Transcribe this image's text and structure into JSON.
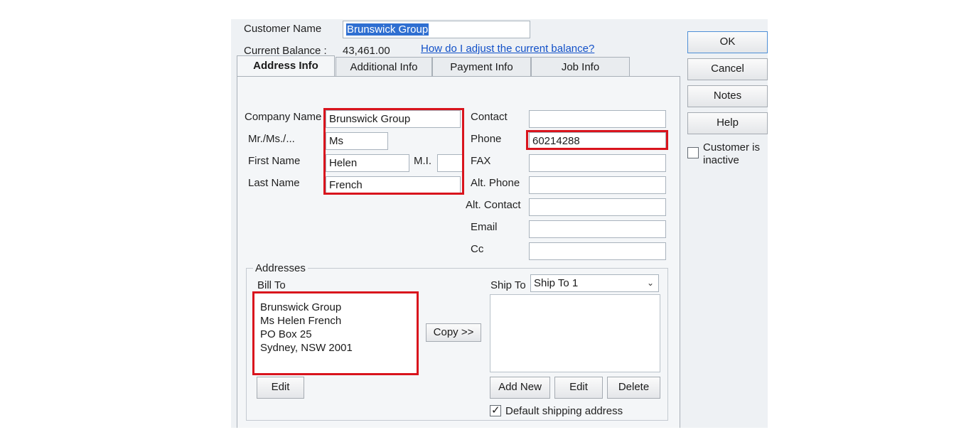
{
  "header": {
    "customer_name_label": "Customer Name",
    "customer_name_value": "Brunswick Group",
    "current_balance_label": "Current Balance :",
    "current_balance_value": "43,461.00",
    "adjust_link": "How do I adjust the current balance?"
  },
  "tabs": [
    {
      "label": "Address Info",
      "active": true
    },
    {
      "label": "Additional Info",
      "active": false
    },
    {
      "label": "Payment Info",
      "active": false
    },
    {
      "label": "Job Info",
      "active": false
    }
  ],
  "side_buttons": {
    "ok": "OK",
    "cancel": "Cancel",
    "notes": "Notes",
    "help": "Help",
    "inactive_label_line1": "Customer is",
    "inactive_label_line2": "inactive"
  },
  "name_fields": {
    "company_name_label": "Company Name",
    "company_name_value": "Brunswick Group",
    "mr_ms_label": "Mr./Ms./...",
    "mr_ms_value": "Ms",
    "first_name_label": "First Name",
    "first_name_value": "Helen",
    "mi_label": "M.I.",
    "mi_value": "",
    "last_name_label": "Last Name",
    "last_name_value": "French"
  },
  "contact_fields": {
    "contact_label": "Contact",
    "contact_value": "",
    "phone_label": "Phone",
    "phone_value": "60214288",
    "fax_label": "FAX",
    "fax_value": "",
    "alt_phone_label": "Alt. Phone",
    "alt_phone_value": "",
    "alt_contact_label": "Alt. Contact",
    "alt_contact_value": "",
    "email_label": "Email",
    "email_value": "",
    "cc_label": "Cc",
    "cc_value": ""
  },
  "addresses": {
    "group_label": "Addresses",
    "bill_to_label": "Bill To",
    "bill_to_lines": [
      "Brunswick Group",
      "Ms Helen French",
      "PO Box 25",
      "Sydney, NSW 2001"
    ],
    "bill_edit_button": "Edit",
    "copy_button": "Copy >>",
    "ship_to_label": "Ship To",
    "ship_to_selected": "Ship To 1",
    "add_new_button": "Add New",
    "ship_edit_button": "Edit",
    "delete_button": "Delete",
    "default_shipping_label": "Default shipping address",
    "default_shipping_checked": true
  },
  "colors": {
    "highlight_red": "#d9141d",
    "link_blue": "#1150c8",
    "selection_blue": "#2f6fd1"
  }
}
